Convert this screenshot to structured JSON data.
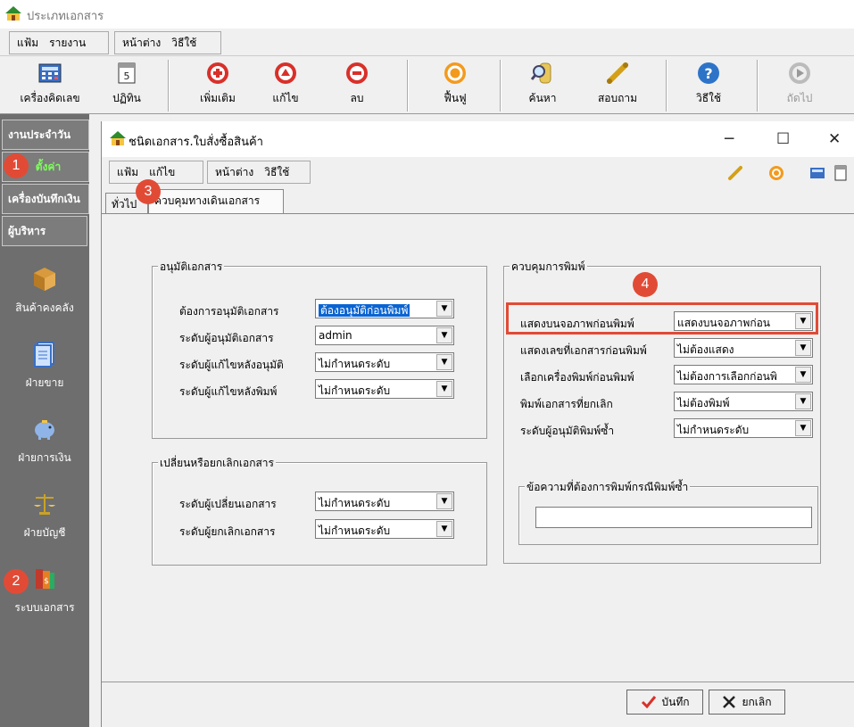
{
  "app": {
    "title": "ประเภทเอกสาร"
  },
  "menubar": {
    "file": "แฟ้ม",
    "report": "รายงาน",
    "window": "หน้าต่าง",
    "help": "วิธีใช้"
  },
  "toolbar": {
    "calculator": "เครื่องคิดเลข",
    "calendar": "ปฏิทิน",
    "add": "เพิ่มเติม",
    "edit": "แก้ไข",
    "delete": "ลบ",
    "restore": "ฟื้นฟู",
    "search": "ค้นหา",
    "inquiry": "สอบถาม",
    "help": "วิธีใช้",
    "next": "ถัดไป"
  },
  "sidebar": {
    "daily": "งานประจำวัน",
    "settings": "ตั้งค่า",
    "recorder": "เครื่องบันทึกเงิน",
    "admin": "ผู้บริหาร",
    "items": [
      {
        "label": "สินค้าคงคลัง"
      },
      {
        "label": "ฝ่ายขาย"
      },
      {
        "label": "ฝ่ายการเงิน"
      },
      {
        "label": "ฝ่ายบัญชี"
      },
      {
        "label": "ระบบเอกสาร"
      }
    ]
  },
  "badges": {
    "b1": "1",
    "b2": "2",
    "b3": "3",
    "b4": "4"
  },
  "doc": {
    "title": "ชนิดเอกสาร.ใบสั่งซื้อสินค้า",
    "menu": {
      "file": "แฟ้ม",
      "edit": "แก้ไข",
      "window": "หน้าต่าง",
      "help": "วิธีใช้"
    },
    "tabs": {
      "general": "ทั่วไป",
      "control": "ควบคุมทางเดินเอกสาร"
    }
  },
  "approve": {
    "title": "อนุมัติเอกสาร",
    "fields": [
      {
        "label": "ต้องการอนุมัติเอกสาร",
        "value": "ต้องอนุมัติก่อนพิมพ์"
      },
      {
        "label": "ระดับผู้อนุมัติเอกสาร",
        "value": "admin"
      },
      {
        "label": "ระดับผู้แก้ไขหลังอนุมัติ",
        "value": "ไม่กำหนดระดับ"
      },
      {
        "label": "ระดับผู้แก้ไขหลังพิมพ์",
        "value": "ไม่กำหนดระดับ"
      }
    ]
  },
  "change": {
    "title": "เปลี่ยนหรือยกเลิกเอกสาร",
    "fields": [
      {
        "label": "ระดับผู้เปลี่ยนเอกสาร",
        "value": "ไม่กำหนดระดับ"
      },
      {
        "label": "ระดับผู้ยกเลิกเอกสาร",
        "value": "ไม่กำหนดระดับ"
      }
    ]
  },
  "print": {
    "title": "ควบคุมการพิมพ์",
    "fields": [
      {
        "label": "แสดงบนจอภาพก่อนพิมพ์",
        "value": "แสดงบนจอภาพก่อน"
      },
      {
        "label": "แสดงเลขที่เอกสารก่อนพิมพ์",
        "value": "ไม่ต้องแสดง"
      },
      {
        "label": "เลือกเครื่องพิมพ์ก่อนพิมพ์",
        "value": "ไม่ต้องการเลือกก่อนพิ"
      },
      {
        "label": "พิมพ์เอกสารที่ยกเลิก",
        "value": "ไม่ต้องพิมพ์"
      },
      {
        "label": "ระดับผู้อนุมัติพิมพ์ซ้ำ",
        "value": "ไม่กำหนดระดับ"
      }
    ],
    "reprint_title": "ข้อความที่ต้องการพิมพ์กรณีพิมพ์ซ้ำ",
    "reprint_value": ""
  },
  "footer": {
    "save": "บันทึก",
    "cancel": "ยกเลิก"
  }
}
